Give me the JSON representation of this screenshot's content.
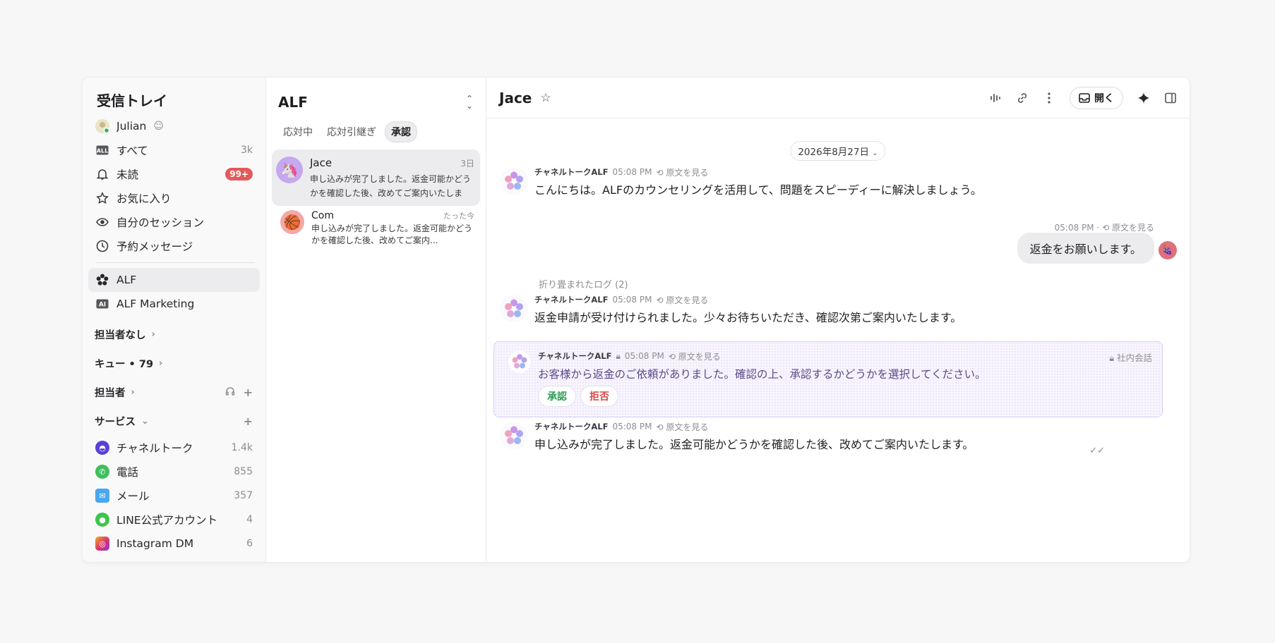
{
  "sidebar": {
    "title": "受信トレイ",
    "user": {
      "name": "Julian"
    },
    "items": [
      {
        "label": "すべて",
        "count": "3k"
      },
      {
        "label": "未読",
        "badge": "99+"
      },
      {
        "label": "お気に入り"
      },
      {
        "label": "自分のセッション"
      },
      {
        "label": "予約メッセージ"
      }
    ],
    "workspaces": [
      {
        "label": "ALF"
      },
      {
        "label": "ALF Marketing"
      }
    ],
    "sections": {
      "unassigned": "担当者なし",
      "queue": "キュー • 79",
      "assignee": "担当者",
      "services": "サービス"
    },
    "services": [
      {
        "label": "チャネルトーク",
        "count": "1.4k",
        "color": "#5b3fd9"
      },
      {
        "label": "電話",
        "count": "855",
        "color": "#3fbf5e"
      },
      {
        "label": "メール",
        "count": "357",
        "color": "#4aa8f0"
      },
      {
        "label": "LINE公式アカウント",
        "count": "4",
        "color": "#3ec44a"
      },
      {
        "label": "Instagram DM",
        "count": "6",
        "color": "#d8336f"
      }
    ]
  },
  "list": {
    "title": "ALF",
    "tabs": [
      "応対中",
      "応対引継ぎ",
      "承認"
    ],
    "conversations": [
      {
        "name": "Jace",
        "time": "3日",
        "preview": "申し込みが完了しました。返金可能かどうかを確認した後、改めてご案内いたします。"
      },
      {
        "name": "Com",
        "time": "たった今",
        "preview": "申し込みが完了しました。返金可能かどうかを確認した後、改めてご案内..."
      }
    ]
  },
  "chat": {
    "title": "Jace",
    "open_label": "開く",
    "date": "2026年8月27日",
    "collapsed_label": "折り畳まれたログ (2)",
    "messages": [
      {
        "sender": "チャネルトークALF",
        "time": "05:08 PM",
        "orig": "原文を見る",
        "text": "こんにちは。ALFのカウンセリングを活用して、問題をスピーディーに解決しましょう。"
      },
      {
        "sender": "チャネルトークALF",
        "time": "05:08 PM",
        "orig": "原文を見る",
        "text": "返金申請が受け付けられました。少々お待ちいただき、確認次第ご案内いたします。"
      },
      {
        "sender": "チャネルトークALF",
        "time": "05:08 PM",
        "orig": "原文を見る",
        "text": "申し込みが完了しました。返金可能かどうかを確認した後、改めてご案内いたします。"
      }
    ],
    "user_message": {
      "time": "05:08 PM",
      "orig": "原文を見る",
      "text": "返金をお願いします。"
    },
    "internal": {
      "sender": "チャネルトークALF",
      "time": "05:08 PM",
      "orig": "原文を見る",
      "tag": "社内会話",
      "text": "お客様から返金のご依頼がありました。確認の上、承認するかどうかを選択してください。",
      "approve": "承認",
      "reject": "拒否"
    }
  }
}
